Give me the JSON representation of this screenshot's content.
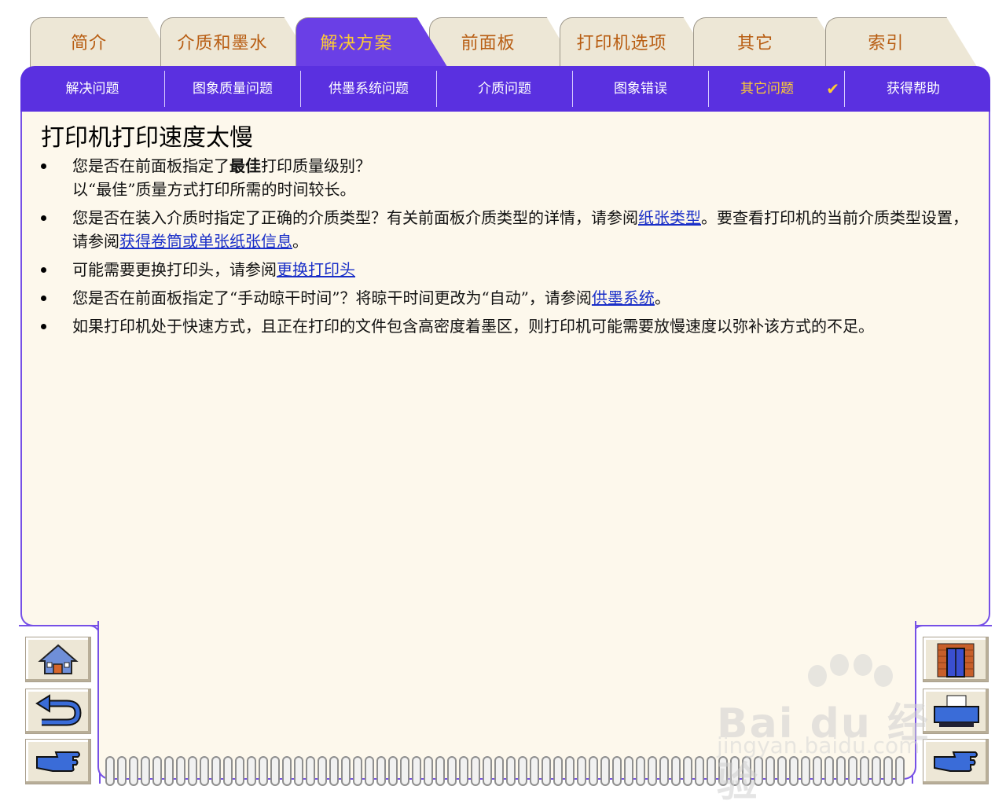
{
  "tabs": [
    {
      "label": "简介"
    },
    {
      "label": "介质和墨水"
    },
    {
      "label": "解决方案"
    },
    {
      "label": "前面板"
    },
    {
      "label": "打印机选项"
    },
    {
      "label": "其它"
    },
    {
      "label": "索引"
    }
  ],
  "subtabs": [
    {
      "label": "解决问题"
    },
    {
      "label": "图象质量问题"
    },
    {
      "label": "供墨系统问题"
    },
    {
      "label": "介质问题"
    },
    {
      "label": "图象错误"
    },
    {
      "label": "其它问题"
    },
    {
      "label": "获得帮助"
    }
  ],
  "active_subtab_check": "✔",
  "page_title": "打印机打印速度太慢",
  "bullets": {
    "b1_pre": "您是否在前面板指定了",
    "b1_bold": "最佳",
    "b1_post": "打印质量级别？",
    "b1_line2": "以“最佳”质量方式打印所需的时间较长。",
    "b2_pre": "您是否在装入介质时指定了正确的介质类型？有关前面板介质类型的详情，请参阅",
    "b2_link1": "纸张类型",
    "b2_mid": "。要查看打印机的当前介质类型设置，请参阅",
    "b2_link2": "获得卷筒或单张纸张信息",
    "b2_post": "。",
    "b3_pre": "可能需要更换打印头，请参阅",
    "b3_link": "更换打印头",
    "b4_pre": "您是否在前面板指定了“手动晾干时间”？将晾干时间更改为“自动”，请参阅",
    "b4_link": "供墨系统",
    "b4_post": "。",
    "b5": "如果打印机处于快速方式，且正在打印的文件包含高密度着墨区，则打印机可能需要放慢速度以弥补该方式的不足。"
  },
  "nav_buttons": {
    "left": [
      "home-icon",
      "back-icon",
      "next-icon"
    ],
    "right": [
      "door-icon",
      "printer-icon",
      "next-icon"
    ]
  },
  "watermark": {
    "text": "Bai du 经验",
    "sub": "jingyan.baidu.com"
  },
  "colors": {
    "nav_purple": "#5a30e0",
    "active_text": "#ffcc33",
    "tab_text": "#b85d12",
    "panel_bg": "#fdf8ec",
    "link": "#1a2fc8"
  }
}
